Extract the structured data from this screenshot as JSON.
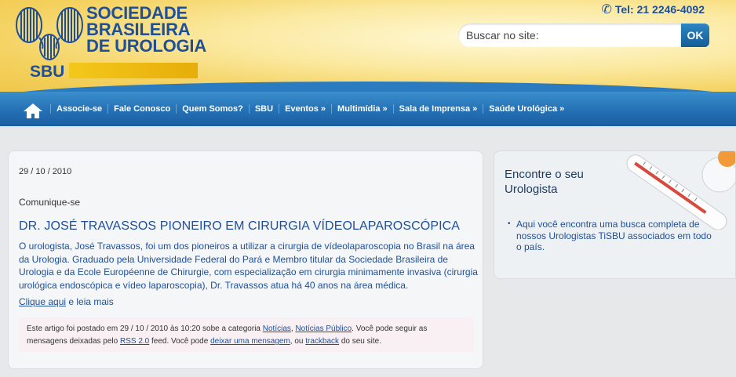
{
  "header": {
    "logo_line1": "SOCIEDADE",
    "logo_line2": "BRASILEIRA",
    "logo_line3": "DE UROLOGIA",
    "logo_short": "SBU",
    "phone": "Tel: 21 2246-4092",
    "search_placeholder": "Buscar no site:",
    "search_button": "OK"
  },
  "nav": {
    "items": [
      "Associe-se",
      "Fale Conosco",
      "Quem Somos?",
      "SBU",
      "Eventos »",
      "Multimídia »",
      "Sala de Imprensa »",
      "Saúde Urológica »"
    ]
  },
  "article": {
    "date": "29 / 10 / 2010",
    "category": "Comunique-se",
    "title": "DR. JOSÉ TRAVASSOS PIONEIRO EM CIRURGIA VÍDEOLAPAROSCÓPICA",
    "body": "O urologista, José Travassos, foi um dos pioneiros a utilizar a cirurgia de vídeolaparoscopia no Brasil na área da Urologia. Graduado pela Universidade Federal do Pará e Membro titular da Sociedade Brasileira de Urologia e da Ecole Européenne de Chirurgie, com especialização em cirurgia minimamente invasiva (cirurgia urológica endoscópica e vídeo laparoscopia), Dr. Travassos atua há 40 anos na área médica.",
    "more_link": "Clique aqui",
    "more_text": " e leia mais",
    "footer": {
      "p1": "Este artigo foi postado em 29 / 10 / 2010 às 10:20 sobe a categoria ",
      "cat1": "Notícias",
      "sep1": ", ",
      "cat2": "Notícias Público",
      "p2": ". Você pode seguir as mensagens deixadas pelo ",
      "rss": "RSS 2.0",
      "p3": " feed. Você pode ",
      "leave": "deixar uma mensagem",
      "p4": ", ou ",
      "trackback": "trackback",
      "p5": " do seu site."
    }
  },
  "sidebar": {
    "title_line1": "Encontre o seu",
    "title_line2": "Urologista",
    "text": "Aqui você encontra uma busca completa de nossos Urologistas TiSBU associados em todo o país."
  },
  "colors": {
    "brand_blue": "#1d4f9a",
    "nav_blue": "#2470b5",
    "header_yellow": "#f4d15e"
  }
}
